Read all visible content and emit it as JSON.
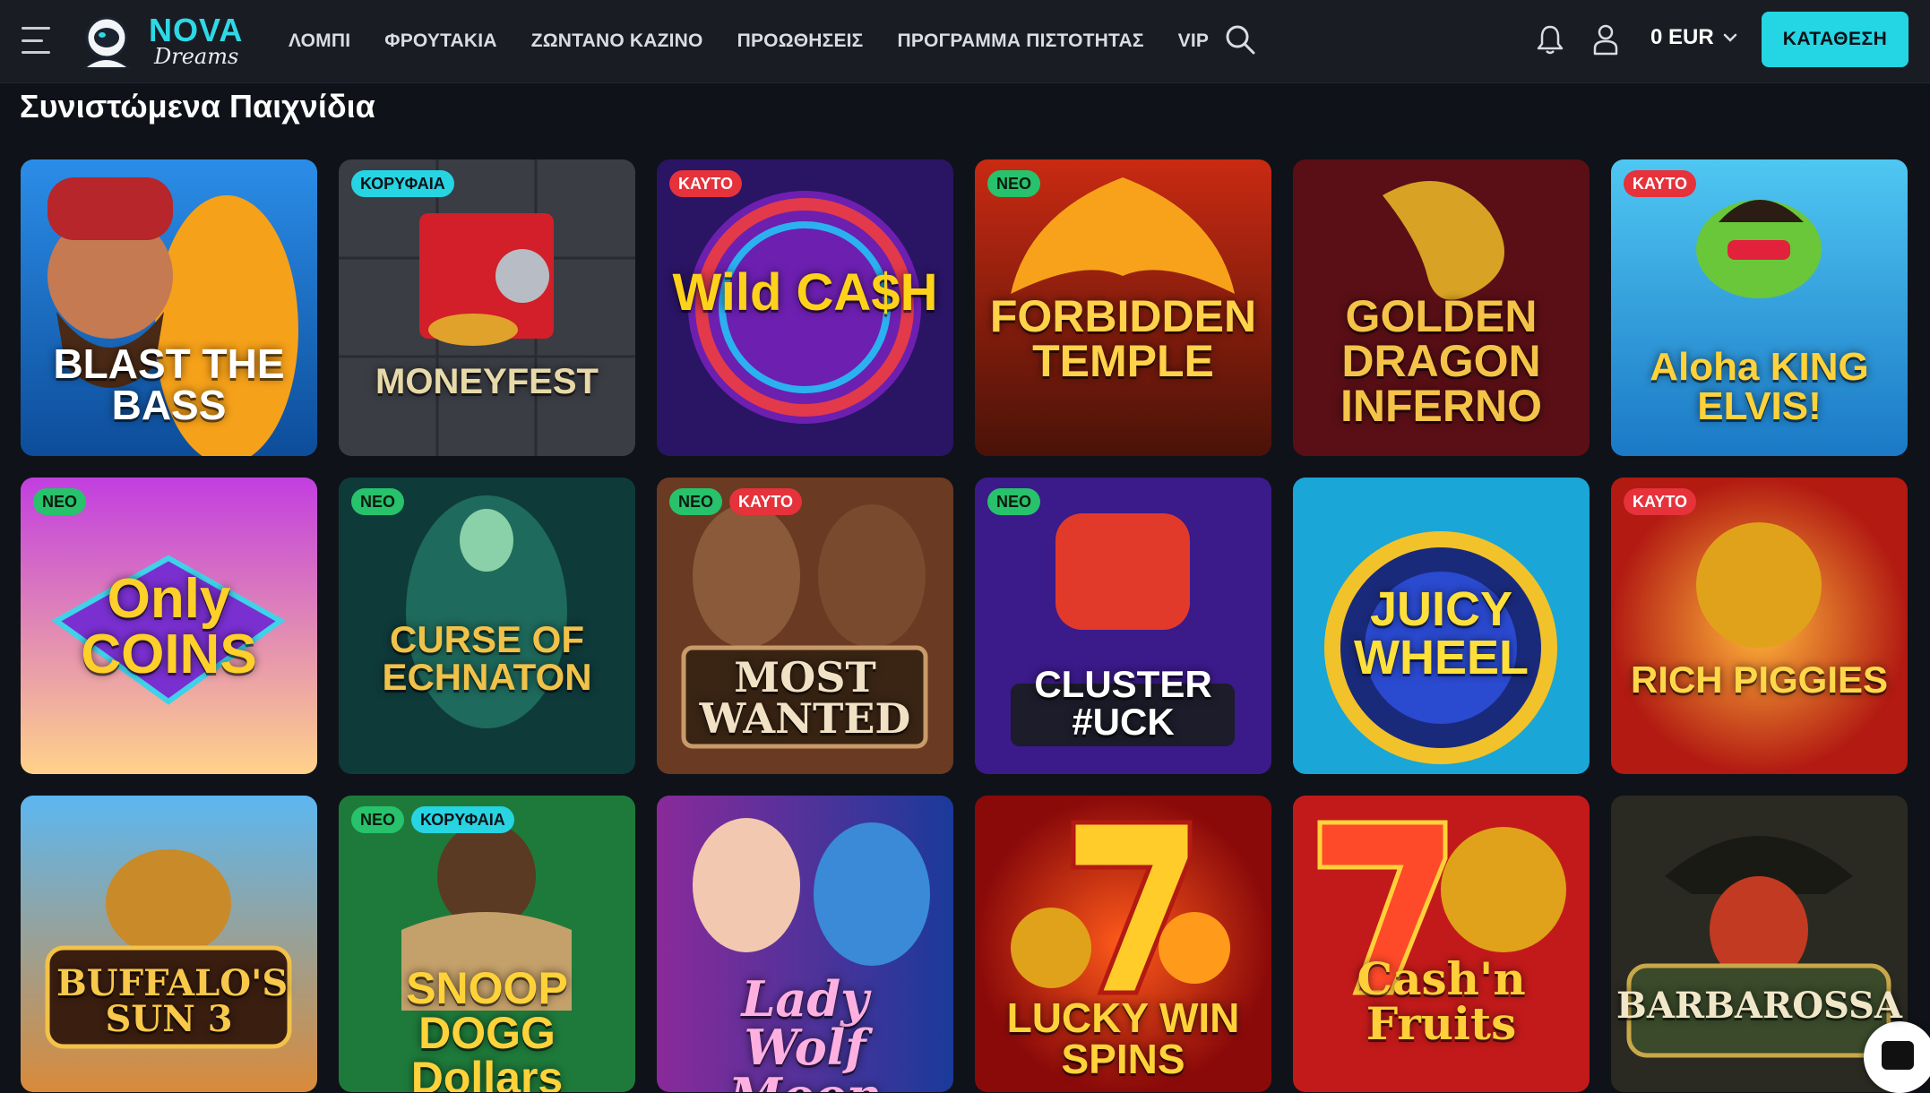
{
  "header": {
    "logo_main": "NOVA",
    "logo_sub": "Dreams",
    "nav": [
      "ΛΟΜΠΙ",
      "ΦΡΟΥΤΑΚΙΑ",
      "ΖΩΝΤΑΝΟ ΚΑΖΙΝΟ",
      "ΠΡΟΩΘΗΣΕΙΣ",
      "ΠΡΟΓΡΑΜΜΑ ΠΙΣΤΟΤΗΤΑΣ",
      "VIP"
    ],
    "balance": "0 EUR",
    "deposit_label": "ΚΑΤΑΘΕΣΗ"
  },
  "section_title": "Συνιστώμενα Παιχνίδια",
  "badge_labels": {
    "new": "ΝΕΟ",
    "hot": "ΚΑΥΤΟ",
    "top": "ΚΟΡΥΦΑΙΑ"
  },
  "games": [
    {
      "name": "BLAST THE BASS",
      "badges": []
    },
    {
      "name": "MONEYFEST",
      "badges": [
        "top"
      ]
    },
    {
      "name": "Wild CA$H",
      "badges": [
        "hot"
      ]
    },
    {
      "name": "FORBIDDEN TEMPLE",
      "badges": [
        "new"
      ]
    },
    {
      "name": "GOLDEN DRAGON INFERNO",
      "badges": []
    },
    {
      "name": "Aloha KING ELVIS!",
      "badges": [
        "hot"
      ]
    },
    {
      "name": "Only COINS",
      "badges": [
        "new"
      ]
    },
    {
      "name": "CURSE OF ECHNATON",
      "badges": [
        "new"
      ]
    },
    {
      "name": "MOST WANTED",
      "badges": [
        "new",
        "hot"
      ]
    },
    {
      "name": "CLUSTER #UCK",
      "badges": [
        "new"
      ]
    },
    {
      "name": "JUICY WHEEL",
      "badges": []
    },
    {
      "name": "RICH PIGGIES",
      "badges": [
        "hot"
      ]
    },
    {
      "name": "BUFFALO'S SUN 3",
      "badges": []
    },
    {
      "name": "SNOOP DOGG Dollars",
      "badges": [
        "new",
        "top"
      ]
    },
    {
      "name": "Lady Wolf Moon",
      "badges": []
    },
    {
      "name": "LUCKY WIN SPINS",
      "badges": []
    },
    {
      "name": "Cash'n Fruits",
      "badges": []
    },
    {
      "name": "BARBAROSSA",
      "badges": []
    }
  ],
  "icons": [
    "menu-icon",
    "search-icon",
    "bell-icon",
    "user-icon",
    "chevron-down-icon",
    "chat-icon"
  ],
  "colors": {
    "accent": "#24d5e3",
    "badge_new": "#27c26b",
    "badge_hot": "#e5323b",
    "badge_top": "#26d4e2",
    "bg": "#0f1218",
    "header": "#191c23"
  }
}
